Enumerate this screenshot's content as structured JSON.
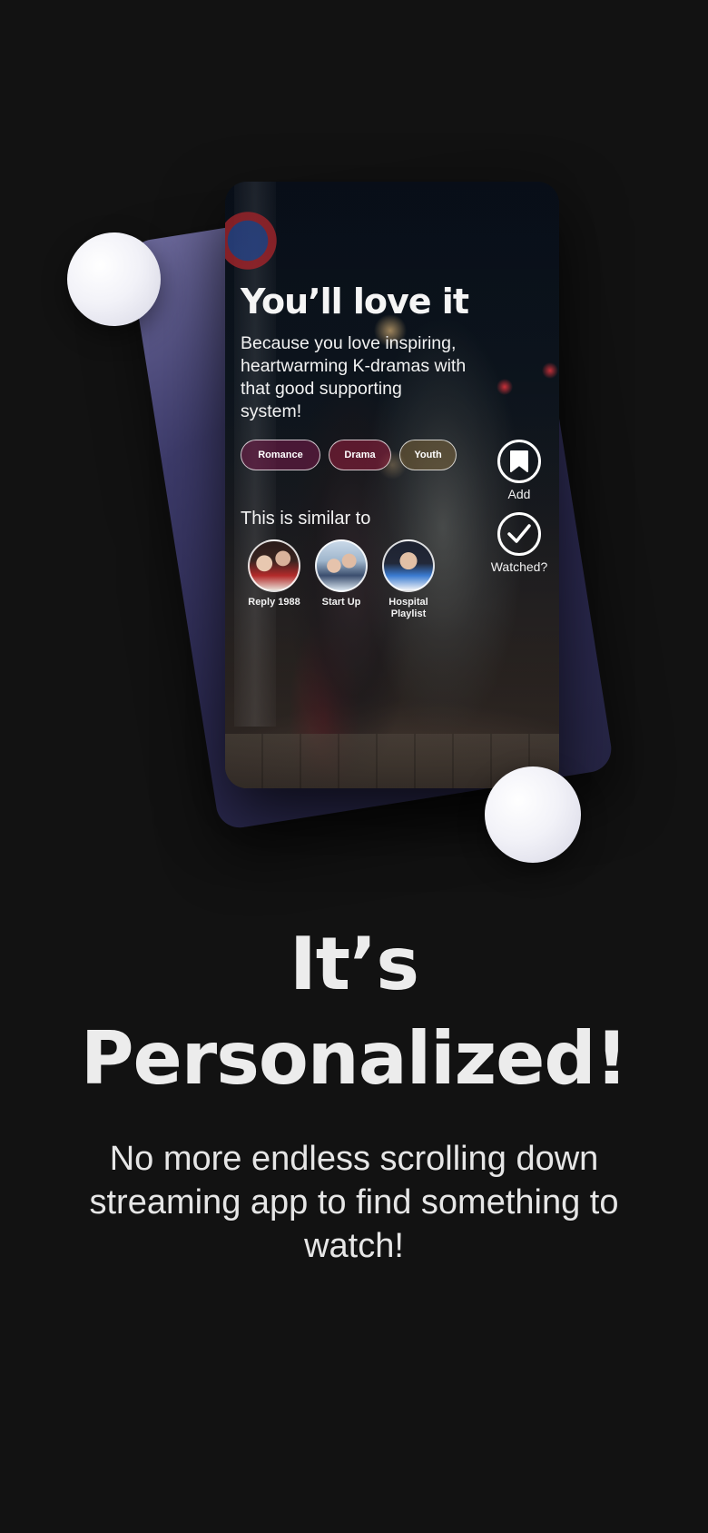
{
  "card": {
    "title": "You’ll love it",
    "subtitle": "Because you love inspiring, heartwarming K-dramas with that good supporting system!",
    "tags": [
      "Romance",
      "Drama",
      "Youth"
    ],
    "actions": {
      "add_label": "Add",
      "watched_label": "Watched?"
    },
    "similar_title": "This is similar to",
    "similar": [
      {
        "name": "Reply 1988"
      },
      {
        "name": "Start Up"
      },
      {
        "name": "Hospital Playlist"
      }
    ]
  },
  "headline": {
    "line1": "It’s",
    "line2": "Personalized!"
  },
  "tagline": "No more endless scrolling down streaming app to find something to watch!",
  "colors": {
    "background": "#121212",
    "back_card": "#2c2a52",
    "tag_romance": "#781c4b",
    "tag_drama": "#8c1e3c",
    "tag_youth": "#8c6e3c"
  },
  "icons": [
    "bookmark-icon",
    "checkmark-icon"
  ]
}
